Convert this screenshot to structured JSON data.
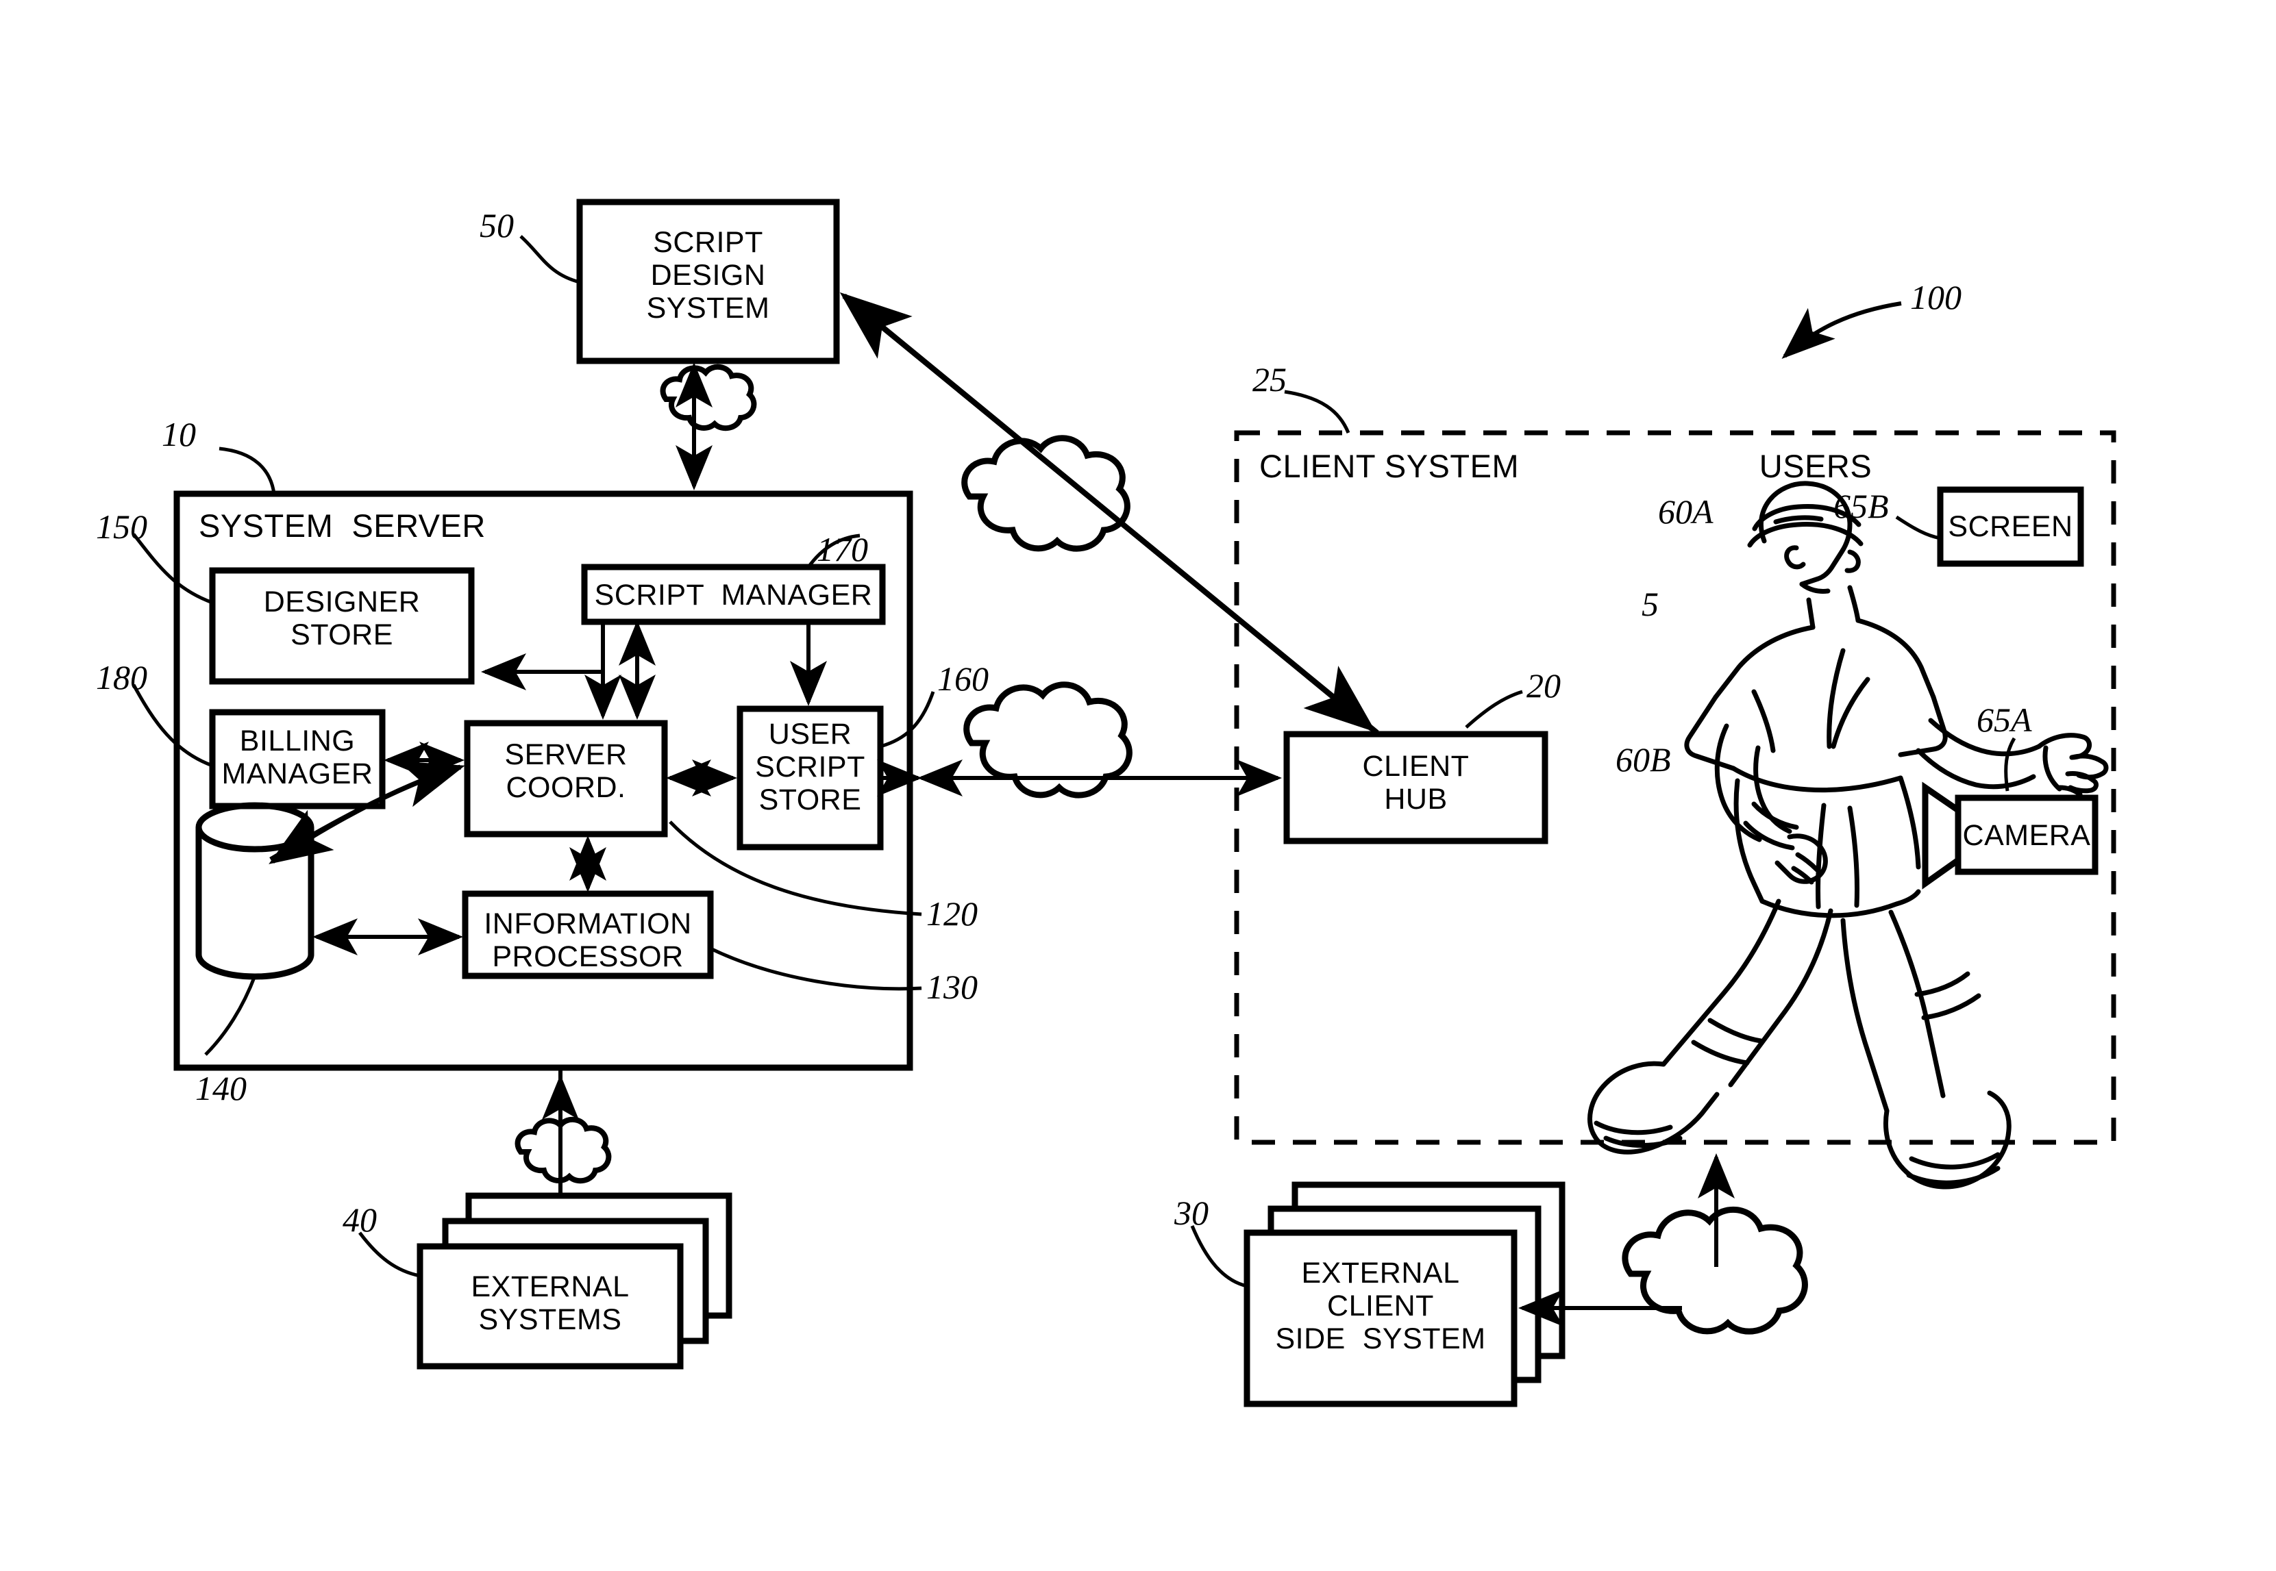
{
  "figure": {
    "kind": "patent-block-diagram",
    "overall_ref": "100"
  },
  "blocks": {
    "script_design_system": {
      "label": "SCRIPT\nDESIGN\nSYSTEM",
      "ref": "50"
    },
    "system_server": {
      "label": "SYSTEM  SERVER",
      "ref": "10"
    },
    "designer_store": {
      "label": "DESIGNER\nSTORE",
      "ref": "150"
    },
    "billing_manager": {
      "label": "BILLING\nMANAGER",
      "ref": "180"
    },
    "script_manager": {
      "label": "SCRIPT  MANAGER",
      "ref": "170"
    },
    "server_coord": {
      "label": "SERVER\nCOORD.",
      "ref": "120"
    },
    "user_script_store": {
      "label": "USER\nSCRIPT\nSTORE",
      "ref": "160"
    },
    "information_processor": {
      "label": "INFORMATION\nPROCESSOR",
      "ref": "130"
    },
    "database": {
      "label": "",
      "ref": "140"
    },
    "external_systems": {
      "label": "EXTERNAL\nSYSTEMS",
      "ref": "40"
    },
    "client_system": {
      "label": "CLIENT SYSTEM",
      "ref": "25"
    },
    "client_hub": {
      "label": "CLIENT\nHUB",
      "ref": "20"
    },
    "external_client_side_system": {
      "label": "EXTERNAL\nCLIENT\nSIDE  SYSTEM",
      "ref": "30"
    },
    "screen": {
      "label": "SCREEN",
      "ref": "65B"
    },
    "camera": {
      "label": "CAMERA",
      "ref": "65A"
    },
    "users": {
      "label": "USERS"
    },
    "user_figure": {
      "ref": "5"
    },
    "sensor_head": {
      "ref": "60A"
    },
    "sensor_wrist": {
      "ref": "60B"
    }
  },
  "colors": {
    "line": "#000000",
    "background": "#ffffff"
  }
}
